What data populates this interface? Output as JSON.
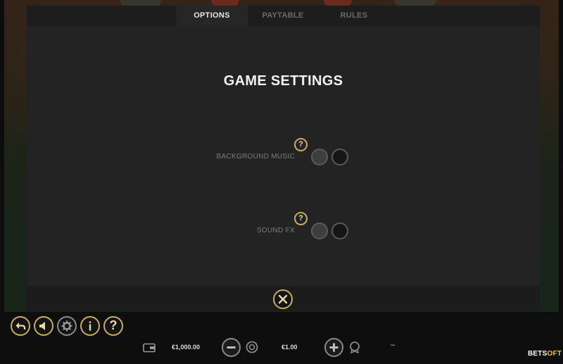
{
  "tabs": [
    {
      "label": "OPTIONS",
      "active": true
    },
    {
      "label": "PAYTABLE",
      "active": false
    },
    {
      "label": "RULES",
      "active": false
    }
  ],
  "settings": {
    "title": "GAME SETTINGS",
    "background_music": {
      "label": "BACKGROUND MUSIC",
      "help": "?"
    },
    "sound_fx": {
      "label": "SOUND FX",
      "help": "?"
    }
  },
  "controls": {
    "help": "?",
    "balance": "€1,000.00",
    "bet": "€1.00",
    "win": "–"
  },
  "brand": {
    "part1": "BETS",
    "part2": "OFT"
  },
  "colors": {
    "accent_gold": "#c8ac66",
    "panel": "#232323",
    "tab_bar": "#1d1d1d",
    "brand_yellow": "#f0c03a"
  },
  "icons": [
    "close-icon",
    "back-icon",
    "sound-icon",
    "gear-icon",
    "info-icon",
    "help-icon",
    "wallet-icon",
    "minus-icon",
    "plus-icon",
    "chips-icon",
    "coin-icon"
  ]
}
